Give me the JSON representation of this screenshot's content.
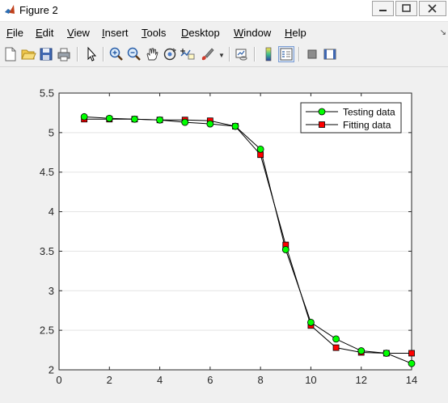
{
  "window": {
    "title": "Figure 2",
    "controls": [
      "minimize",
      "maximize",
      "close"
    ]
  },
  "menu": [
    {
      "label": "File",
      "mnemonic": "F"
    },
    {
      "label": "Edit",
      "mnemonic": "E"
    },
    {
      "label": "View",
      "mnemonic": "V"
    },
    {
      "label": "Insert",
      "mnemonic": "I"
    },
    {
      "label": "Tools",
      "mnemonic": "T"
    },
    {
      "label": "Desktop",
      "mnemonic": "D"
    },
    {
      "label": "Window",
      "mnemonic": "W"
    },
    {
      "label": "Help",
      "mnemonic": "H"
    }
  ],
  "toolbar": {
    "icons": [
      "new-figure-icon",
      "open-icon",
      "save-icon",
      "print-icon",
      "pointer-icon",
      "zoom-in-icon",
      "zoom-out-icon",
      "pan-icon",
      "rotate-3d-icon",
      "data-cursor-icon",
      "brush-icon",
      "link-plot-icon",
      "colorbar-icon",
      "legend-icon",
      "hide-plot-tools-icon",
      "show-plot-tools-icon"
    ],
    "pressed": "legend-icon"
  },
  "chart_data": {
    "type": "line",
    "x": [
      1,
      2,
      3,
      4,
      5,
      6,
      7,
      8,
      9,
      10,
      11,
      12,
      13,
      14
    ],
    "xlim": [
      0,
      14
    ],
    "ylim": [
      2,
      5.5
    ],
    "xticks": [
      0,
      2,
      4,
      6,
      8,
      10,
      12,
      14
    ],
    "yticks": [
      2,
      2.5,
      3,
      3.5,
      4,
      4.5,
      5,
      5.5
    ],
    "xtick_labels": [
      "0",
      "2",
      "4",
      "6",
      "8",
      "10",
      "12",
      "14"
    ],
    "ytick_labels": [
      "2",
      "2.5",
      "3",
      "3.5",
      "4",
      "4.5",
      "5",
      "5.5"
    ],
    "grid": "horizontal",
    "legend_position": "top-right",
    "series": [
      {
        "name": "Testing data",
        "marker": "circle",
        "color": "#00ff00",
        "values": [
          5.2,
          5.18,
          5.17,
          5.16,
          5.13,
          5.11,
          5.08,
          4.79,
          3.52,
          2.6,
          2.39,
          2.24,
          2.21,
          2.08
        ]
      },
      {
        "name": "Fitting data",
        "marker": "square",
        "color": "#ff0000",
        "values": [
          5.17,
          5.17,
          5.17,
          5.16,
          5.16,
          5.15,
          5.08,
          4.72,
          3.58,
          2.56,
          2.28,
          2.22,
          2.21,
          2.21
        ]
      }
    ]
  }
}
